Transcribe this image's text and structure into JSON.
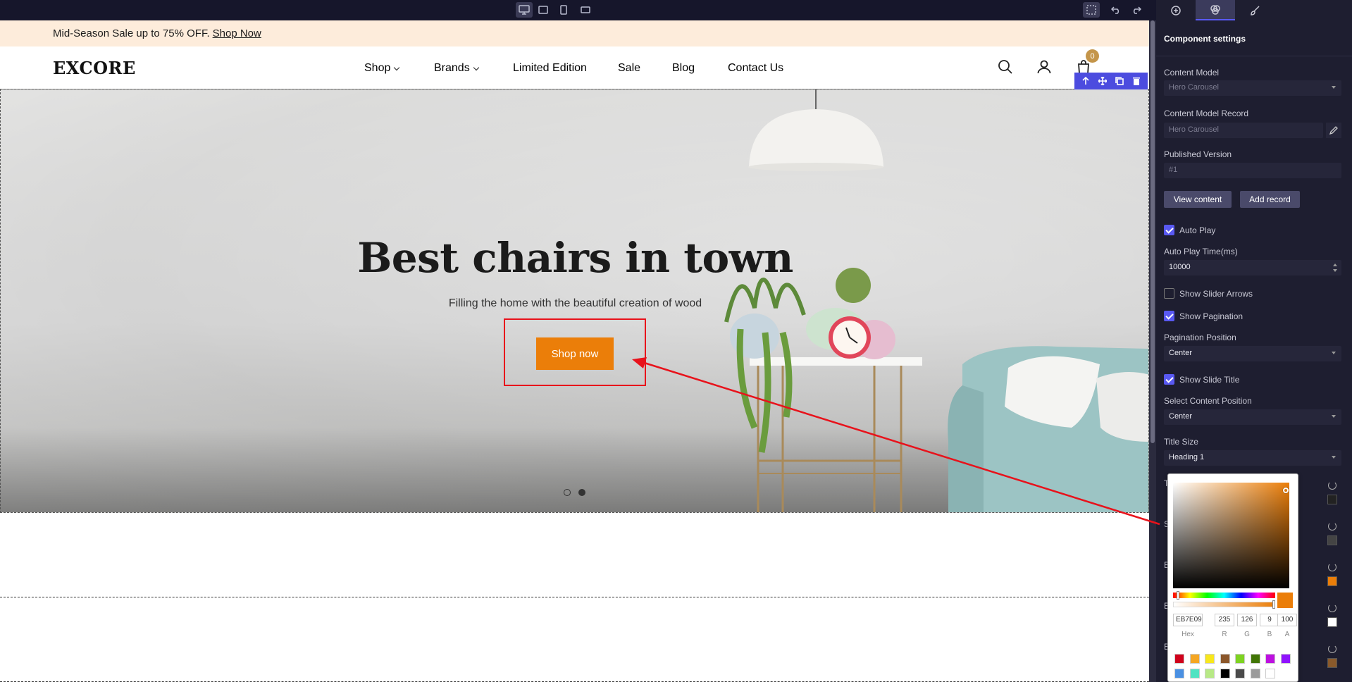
{
  "editor": {
    "device_buttons": [
      "desktop-icon",
      "tablet-landscape-icon",
      "mobile-icon",
      "tablet-icon"
    ],
    "tool_icons": [
      "select-icon",
      "undo-icon",
      "redo-icon"
    ]
  },
  "promo": {
    "text": "Mid-Season Sale up to 75% OFF.",
    "link": "Shop Now"
  },
  "header": {
    "logo": "EXCORE",
    "nav": [
      {
        "label": "Shop",
        "has_dropdown": true
      },
      {
        "label": "Brands",
        "has_dropdown": true
      },
      {
        "label": "Limited Edition",
        "has_dropdown": false
      },
      {
        "label": "Sale",
        "has_dropdown": false
      },
      {
        "label": "Blog",
        "has_dropdown": false
      },
      {
        "label": "Contact Us",
        "has_dropdown": false
      }
    ],
    "cart_count": "0"
  },
  "hero": {
    "title": "Best chairs in town",
    "subtitle": "Filling the home with the beautiful creation of wood",
    "button": "Shop now",
    "button_color": "#eb7e09",
    "slides": 2,
    "active_slide": 2
  },
  "panel": {
    "tabs": [
      "add-icon",
      "style-icon",
      "brush-icon"
    ],
    "active_tab": 1,
    "title": "Component settings",
    "content_model_label": "Content Model",
    "content_model_value": "Hero Carousel",
    "record_label": "Content Model Record",
    "record_value": "Hero Carousel",
    "published_label": "Published Version",
    "published_value": "#1",
    "view_content": "View content",
    "add_record": "Add record",
    "auto_play": {
      "label": "Auto Play",
      "checked": true
    },
    "auto_play_time_label": "Auto Play Time(ms)",
    "auto_play_time_value": "10000",
    "show_arrows": {
      "label": "Show Slider Arrows",
      "checked": false
    },
    "show_pagination": {
      "label": "Show Pagination",
      "checked": true
    },
    "pagination_position_label": "Pagination Position",
    "pagination_position_value": "Center",
    "show_slide_title": {
      "label": "Show Slide Title",
      "checked": true
    },
    "content_position_label": "Select Content Position",
    "content_position_value": "Center",
    "title_size_label": "Title Size",
    "title_size_value": "Heading 1",
    "hidden_labels": [
      "T",
      "S",
      "B",
      "B",
      "B"
    ],
    "side_swatches": [
      "#222222",
      "#444444",
      "#eb7e09",
      "#ffffff",
      "#8a5a2b"
    ]
  },
  "picker": {
    "hex": "EB7E09",
    "r": "235",
    "g": "126",
    "b": "9",
    "a": "100",
    "labels": [
      "Hex",
      "R",
      "G",
      "B",
      "A"
    ],
    "presets_row1": [
      "#d0021b",
      "#f5a623",
      "#f8e71c",
      "#8b572a",
      "#7ed321",
      "#417505",
      "#bd10e0",
      "#9013fe"
    ],
    "presets_row2": [
      "#4a90e2",
      "#50e3c2",
      "#b8e986",
      "#000000",
      "#4a4a4a",
      "#9b9b9b",
      "#ffffff"
    ]
  }
}
